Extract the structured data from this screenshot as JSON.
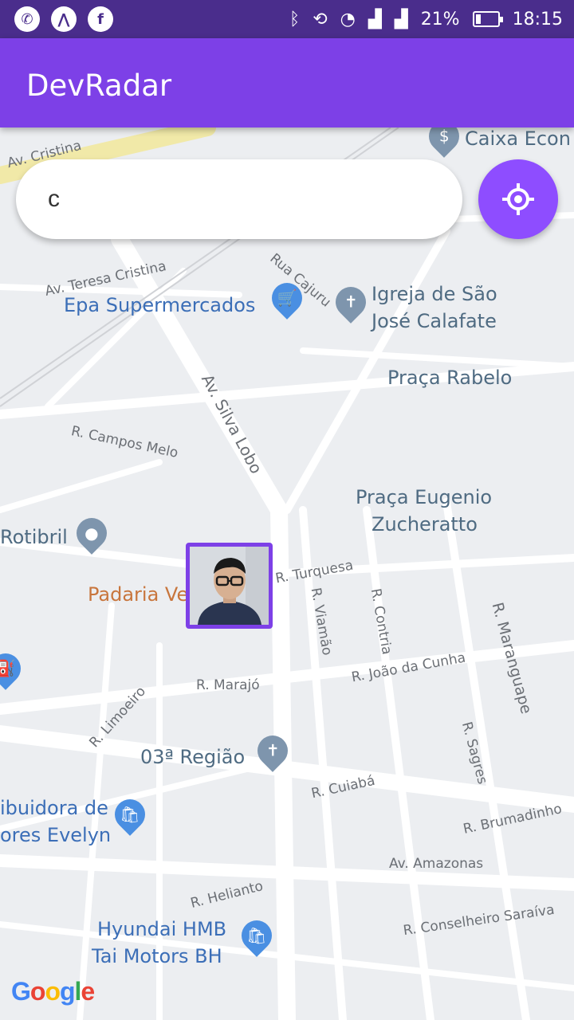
{
  "status_bar": {
    "battery": "21%",
    "time": "18:15",
    "left_icons": [
      "whatsapp-icon",
      "app-icon",
      "facebook-icon"
    ],
    "right_icons": [
      "bluetooth-icon",
      "rotate-icon",
      "wifi-icon",
      "signal-icon",
      "no-signal-icon",
      "battery-icon"
    ]
  },
  "app_bar": {
    "title": "DevRadar",
    "color": "#7d40e7"
  },
  "search": {
    "value": "c"
  },
  "map": {
    "roads": [
      "Av. Cristina",
      "Av. Teresa Cristina",
      "Rua Cajuru",
      "Av. Silva Lobo",
      "R. Campos Melo",
      "R. Turquesa",
      "R. Viamão",
      "R. Contria",
      "R. Maranguape",
      "R. João da Cunha",
      "R. Marajó",
      "R. Limoeiro",
      "R. Sagres",
      "R. Cuiabá",
      "R. Brumadinho",
      "Av. Amazonas",
      "R. Helianto",
      "R. Conselheiro Saraíva"
    ],
    "pois": {
      "caixa": "Caixa Econ",
      "epa": "Epa Supermercados",
      "igreja_1": "Igreja de São",
      "igreja_2": "José Calafate",
      "praca_rabelo": "Praça Rabelo",
      "praca_eugenio_1": "Praça Eugenio",
      "praca_eugenio_2": "Zucheratto",
      "rotibril": "Rotibril",
      "padaria": "Padaria Ve",
      "regiao": "03ª Região",
      "distribuidora_1": "ibuidora de",
      "distribuidora_2": "ores Evelyn",
      "hyundai_1": "Hyundai HMB",
      "hyundai_2": "Tai Motors BH"
    },
    "logo": "Google"
  },
  "colors": {
    "status_bar": "#4a2d8c",
    "accent": "#8e4dff",
    "map_bg": "#eceef1"
  }
}
